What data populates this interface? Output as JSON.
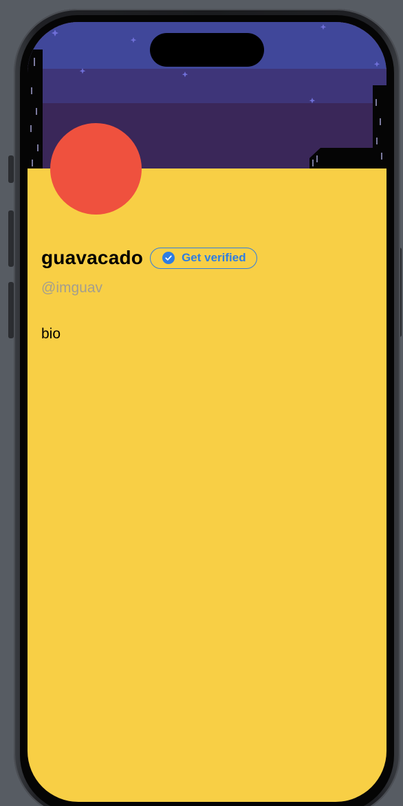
{
  "colors": {
    "page_background": "#575c63",
    "profile_background": "#f8cf45",
    "avatar": "#ef513e",
    "accent": "#2f7de1",
    "handle_text": "#a39e8e",
    "banner_sky_top": "#40479a",
    "banner_sky_mid": "#3e3579",
    "banner_sky_bottom": "#3a2759"
  },
  "banner": {
    "scene": "night-city-skyline",
    "icons": [
      "star-icon",
      "building-silhouette"
    ]
  },
  "profile": {
    "display_name": "guavacado",
    "handle": "@imguav",
    "bio": "bio",
    "verify_button": {
      "label": "Get verified",
      "icon": "check-badge-icon"
    }
  }
}
